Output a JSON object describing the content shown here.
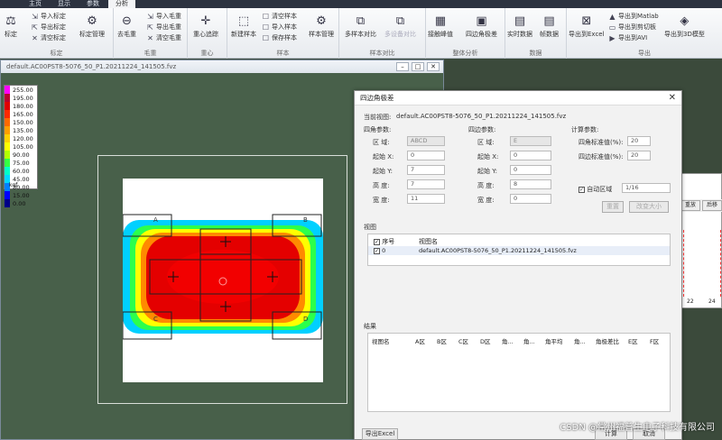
{
  "menu": {
    "tabs": [
      "主页",
      "显示",
      "参数",
      "分析"
    ],
    "active": "分析"
  },
  "ribbon": {
    "groups": [
      {
        "name": "标定",
        "buttons": {
          "main": "标定",
          "import": "导入标定",
          "export": "导出标定",
          "clear": "清空标定",
          "manage": "标定管理"
        }
      },
      {
        "name": "毛重",
        "buttons": {
          "remove": "去毛重",
          "import": "导入毛重",
          "export": "导出毛重",
          "clear": "清空毛重"
        }
      },
      {
        "name": "重心",
        "buttons": {
          "track": "重心追踪"
        }
      },
      {
        "name": "样本",
        "buttons": {
          "new": "新建样本",
          "clear": "清空样本",
          "import": "导入样本",
          "save": "保存样本",
          "manage": "样本管理"
        }
      },
      {
        "name": "样本对比",
        "buttons": {
          "multi": "多样本对比",
          "multi_dev": "多设备对比"
        }
      },
      {
        "name": "整体分析",
        "buttons": {
          "contact": "接触峰值",
          "fourside": "四边角极差"
        }
      },
      {
        "name": "数据",
        "buttons": {
          "realtime": "实时数据",
          "frame": "帧数据"
        }
      },
      {
        "name": "导出",
        "buttons": {
          "excel": "导出到Excel",
          "matlab": "导出到Matlab",
          "clipboard": "导出到剪切板",
          "avi": "导出到AVI",
          "model3d": "导出到3D模型"
        }
      }
    ]
  },
  "child_window": {
    "title": "default.AC00PST8-5076_50_P1.20211224_141505.fvz"
  },
  "legend": {
    "values": [
      "255.00",
      "195.00",
      "180.00",
      "165.00",
      "150.00",
      "135.00",
      "120.00",
      "105.00",
      "90.00",
      "75.00",
      "60.00",
      "45.00",
      "30.00",
      "15.00",
      "0.00"
    ],
    "colors": [
      "#ff00ff",
      "#b8002e",
      "#e00000",
      "#ff2a00",
      "#ff6a00",
      "#ff9f00",
      "#ffd200",
      "#ffff00",
      "#b2ff00",
      "#33ff44",
      "#00ffc8",
      "#00d8ff",
      "#0080ff",
      "#0000ff",
      "#000088"
    ],
    "unit": "kgf"
  },
  "heatmap": {
    "corner_labels": [
      "A",
      "B",
      "C",
      "D"
    ]
  },
  "dialog": {
    "title": "四边角极差",
    "current_view_label": "当前视图:",
    "current_view_value": "default.AC00PST8-5076_50_P1.20211224_141505.fvz",
    "corner_params_label": "四角参数:",
    "side_params_label": "四边参数:",
    "calc_params_label": "计算参数:",
    "region_label": "区 域:",
    "start_x_label": "起始 X:",
    "start_y_label": "起始 Y:",
    "height_label": "高 度:",
    "width_label": "宽 度:",
    "corner_region": "ABCD",
    "corner_start_x": "0",
    "corner_start_y": "7",
    "corner_height": "7",
    "corner_width": "11",
    "side_region": "E",
    "side_start_x": "0",
    "side_start_y": "0",
    "side_height": "8",
    "side_width": "0",
    "corner_thresh_label": "四角标准值(%):",
    "corner_thresh_value": "20",
    "side_thresh_label": "四边标准值(%):",
    "side_thresh_value": "20",
    "auto_region_label": "自动区域",
    "auto_region_value": "1/16",
    "reset_button": "重置",
    "change_size_button": "改变大小",
    "view_section_label": "视图",
    "view_columns": [
      "序号",
      "视图名"
    ],
    "view_rows": [
      {
        "index": "0",
        "name": "default.AC00PST8-5076_50_P1.20211224_141505.fvz"
      }
    ],
    "result_section_label": "结果",
    "result_columns": [
      "视图名",
      "A区",
      "B区",
      "C区",
      "D区",
      "角...",
      "角...",
      "角平均",
      "角...",
      "角极差比",
      "E区",
      "F区"
    ],
    "export_button": "导出Excel",
    "calc_button": "计算",
    "cancel_button": "取消"
  },
  "bg_window": {
    "buttons": [
      "重放",
      "后移"
    ],
    "axis_ticks": [
      "22",
      "24"
    ]
  },
  "watermark": "CSDN @常州福普生电子科技有限公司"
}
